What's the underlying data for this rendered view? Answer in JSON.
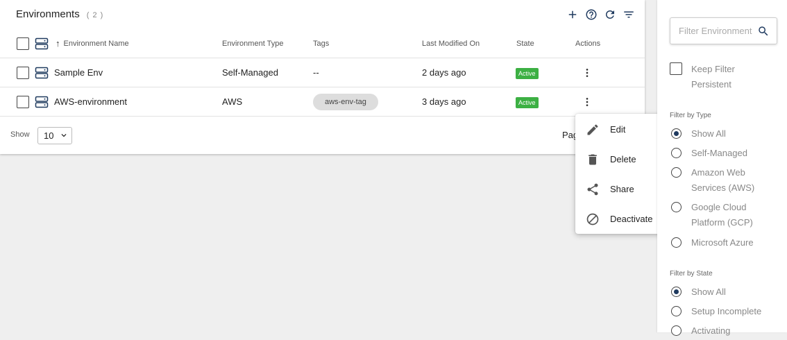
{
  "header": {
    "title": "Environments",
    "count": "( 2 )",
    "icons": [
      "plus-icon",
      "help-icon",
      "refresh-icon",
      "filter-icon"
    ]
  },
  "table": {
    "columns": {
      "name": "Environment Name",
      "type": "Environment Type",
      "tags": "Tags",
      "modified": "Last Modified On",
      "state": "State",
      "actions": "Actions"
    },
    "rows": [
      {
        "name": "Sample Env",
        "type": "Self-Managed",
        "tags": "--",
        "modified": "2 days ago",
        "state": "Active"
      },
      {
        "name": "AWS-environment",
        "type": "AWS",
        "tags": "aws-env-tag",
        "modified": "3 days ago",
        "state": "Active"
      }
    ]
  },
  "footer": {
    "show_label": "Show",
    "page_size": "10",
    "page_label": "Pag"
  },
  "menu": {
    "items": [
      {
        "label": "Edit",
        "icon": "pencil-icon"
      },
      {
        "label": "Delete",
        "icon": "trash-icon"
      },
      {
        "label": "Share",
        "icon": "share-icon"
      },
      {
        "label": "Deactivate",
        "icon": "block-icon"
      }
    ]
  },
  "sidebar": {
    "search_placeholder": "Filter Environment",
    "keep_filter": "Keep Filter Persistent",
    "type_section": "Filter by Type",
    "type_options": [
      "Show All",
      "Self-Managed",
      "Amazon Web Services (AWS)",
      "Google Cloud Platform (GCP)",
      "Microsoft Azure"
    ],
    "state_section": "Filter by State",
    "state_options": [
      "Show All",
      "Setup Incomplete",
      "Activating"
    ]
  },
  "colors": {
    "accent": "#1f3a5f",
    "active_badge": "#3cb043"
  }
}
